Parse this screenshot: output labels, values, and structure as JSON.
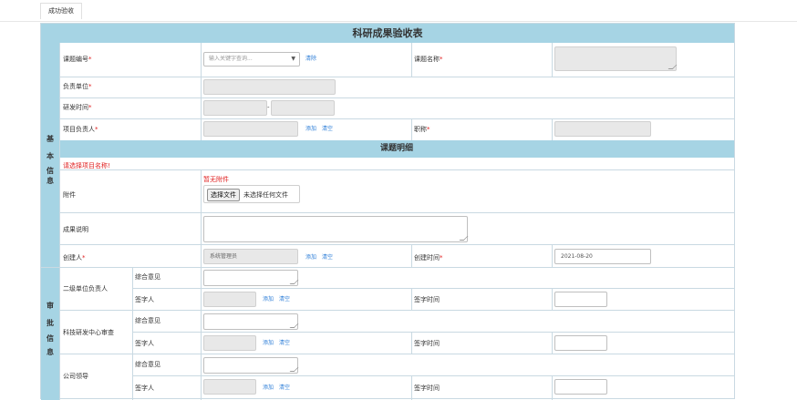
{
  "tab": {
    "label": "成功验收"
  },
  "form": {
    "title": "科研成果验收表",
    "section_basic": {
      "chars": [
        "基",
        "本",
        "信",
        "息"
      ]
    },
    "section_approval": {
      "chars": [
        "审",
        "批",
        "信",
        "息"
      ]
    },
    "subject_no": {
      "label": "课题编号",
      "placeholder": "输入关键字查询...",
      "clear": "清除"
    },
    "subject_name": {
      "label": "课题名称"
    },
    "unit": {
      "label": "负责单位"
    },
    "dev_time": {
      "label": "研发时间"
    },
    "leader": {
      "label": "项目负责人",
      "add": "添加",
      "clear": "清空"
    },
    "title_field": {
      "label": "职称"
    },
    "details_title": "课题明细",
    "select_hint": "请选择项目名称!",
    "attachment": {
      "label": "附件",
      "none": "暂无附件",
      "button": "选择文件",
      "no_file": "未选择任何文件"
    },
    "result_desc": {
      "label": "成果说明"
    },
    "creator": {
      "label": "创建人",
      "value": "系统管理员",
      "add": "添加",
      "clear": "清空"
    },
    "create_time": {
      "label": "创建时间",
      "value": "2021-08-20"
    },
    "approvals": [
      {
        "name": "二级单位负责人",
        "opinion": "综合意见",
        "signer": "签字人",
        "add": "添加",
        "clear": "清空",
        "sign_time": "签字时间"
      },
      {
        "name": "科技研发中心审查",
        "opinion": "综合意见",
        "signer": "签字人",
        "add": "添加",
        "clear": "清空",
        "sign_time": "签字时间"
      },
      {
        "name": "公司领导",
        "opinion": "综合意见",
        "signer": "签字人",
        "add": "添加",
        "clear": "清空",
        "sign_time": "签字时间"
      }
    ],
    "required_mark": "*"
  },
  "colors": {
    "header_bg": "#a6d4e4",
    "border": "#c9d9e2",
    "link": "#2f7fd8",
    "required": "#e02020"
  }
}
